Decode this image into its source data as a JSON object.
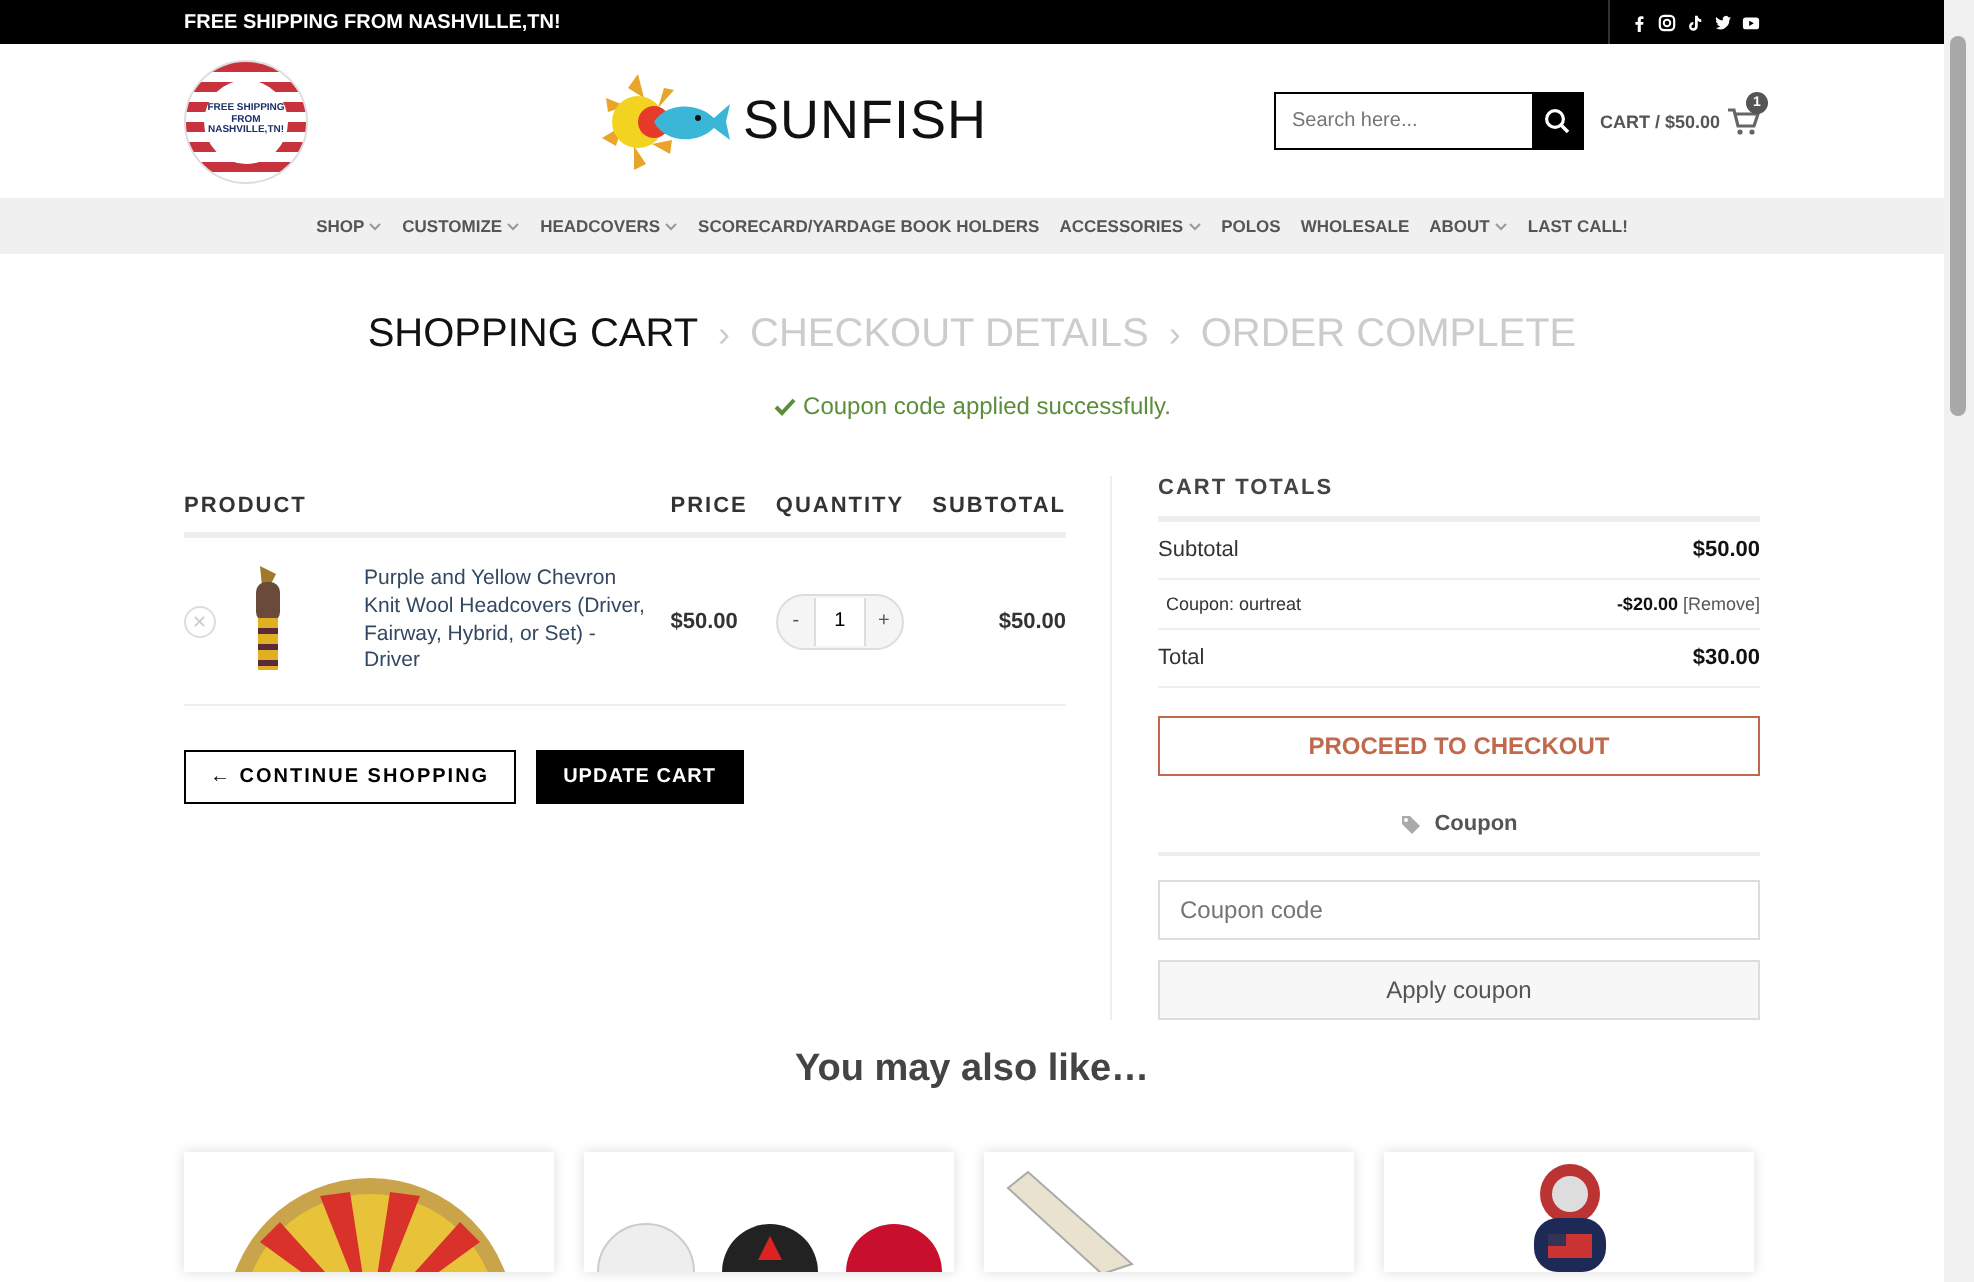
{
  "top_bar": {
    "text": "FREE SHIPPING FROM NASHVILLE,TN!"
  },
  "header": {
    "badge_text": "FREE SHIPPING FROM NASHVILLE,TN!",
    "logo_text": "SUNFISH",
    "search": {
      "placeholder": "Search here..."
    },
    "cart": {
      "label": "CART / $50.00",
      "count": "1"
    }
  },
  "nav": [
    {
      "label": "SHOP",
      "dropdown": true
    },
    {
      "label": "CUSTOMIZE",
      "dropdown": true
    },
    {
      "label": "HEADCOVERS",
      "dropdown": true
    },
    {
      "label": "SCORECARD/YARDAGE BOOK HOLDERS",
      "dropdown": false
    },
    {
      "label": "ACCESSORIES",
      "dropdown": true
    },
    {
      "label": "POLOS",
      "dropdown": false
    },
    {
      "label": "WHOLESALE",
      "dropdown": false
    },
    {
      "label": "ABOUT",
      "dropdown": true
    },
    {
      "label": "LAST CALL!",
      "dropdown": false
    }
  ],
  "steps": [
    {
      "label": "SHOPPING CART",
      "selected": true
    },
    {
      "separator": "›",
      "label": "CHECKOUT DETAILS",
      "selected": false
    },
    {
      "separator": "›",
      "label": "ORDER COMPLETE",
      "selected": false
    }
  ],
  "notice": "Coupon code applied successfully.",
  "cart_table": {
    "columns": [
      "PRODUCT",
      "PRICE",
      "QUANTITY",
      "SUBTOTAL"
    ],
    "rows": [
      {
        "remove": "✕",
        "name": "Purple and Yellow Chevron Knit Wool Headcovers (Driver, Fairway, Hybrid, or Set) - Driver",
        "price": "$50.00",
        "quantity": "1",
        "minus": "-",
        "plus": "+",
        "subtotal": "$50.00"
      }
    ]
  },
  "buttons": {
    "continue": "← CONTINUE SHOPPING",
    "update": "UPDATE CART"
  },
  "totals": {
    "title": "CART TOTALS",
    "rows": [
      {
        "kind": "subtotal",
        "label": "Subtotal",
        "value": "$50.00"
      },
      {
        "kind": "coupon",
        "label": "Coupon: ourtreat",
        "value": "-$20.00",
        "link": "[Remove]"
      },
      {
        "kind": "total",
        "label": "Total",
        "value": "$30.00"
      }
    ],
    "checkout": "PROCEED TO CHECKOUT",
    "coupon_heading": "Coupon",
    "coupon_field": {
      "placeholder": "Coupon code"
    },
    "apply": "Apply coupon"
  },
  "related": {
    "title": "You may also like…"
  }
}
